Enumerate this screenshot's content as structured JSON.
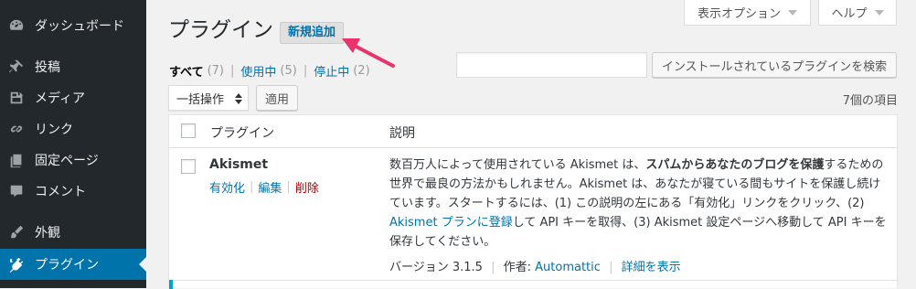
{
  "sidebar": {
    "items": [
      {
        "label": "ダッシュボード",
        "icon": "dashboard-icon"
      },
      {
        "label": "投稿",
        "icon": "pin-icon"
      },
      {
        "label": "メディア",
        "icon": "media-icon"
      },
      {
        "label": "リンク",
        "icon": "link-icon"
      },
      {
        "label": "固定ページ",
        "icon": "page-icon"
      },
      {
        "label": "コメント",
        "icon": "comment-icon"
      },
      {
        "label": "外観",
        "icon": "brush-icon"
      },
      {
        "label": "プラグイン",
        "icon": "plugin-icon"
      }
    ],
    "active_item": "プラグイン",
    "colors": {
      "background": "#23282d",
      "active": "#0073aa"
    }
  },
  "screen_meta": {
    "options_label": "表示オプション",
    "help_label": "ヘルプ"
  },
  "header": {
    "title": "プラグイン",
    "add_new_label": "新規追加"
  },
  "filters": {
    "all": {
      "label": "すべて",
      "count": "(7)"
    },
    "active": {
      "label": "使用中",
      "count": "(5)"
    },
    "inactive": {
      "label": "停止中",
      "count": "(2)"
    }
  },
  "search": {
    "value": "",
    "button_label": "インストールされているプラグインを検索"
  },
  "bulk_actions": {
    "selected": "一括操作",
    "apply_label": "適用"
  },
  "items_count": "7個の項目",
  "table": {
    "columns": {
      "plugin": "プラグイン",
      "description": "説明"
    },
    "rows": [
      {
        "name": "Akismet",
        "actions": {
          "activate": "有効化",
          "edit": "編集",
          "delete": "削除"
        },
        "description": {
          "part1": "数百万人によって使用されている Akismet は、",
          "bold": "スパムからあなたのブログを保護",
          "part2": "するための世界で最良の方法かもしれません。Akismet は、あなたが寝ている間もサイトを保護し続けています。スタートするには、(1) この説明の左にある「有効化」リンクをクリック、(2) ",
          "link": "Akismet プランに登録",
          "part3": "して API キーを取得、(3) Akismet 設定ページへ移動して API キーを保存してください。"
        },
        "meta": {
          "version": "バージョン 3.1.5",
          "author_prefix": "作者: ",
          "author": "Automattic",
          "details": "詳細を表示"
        }
      }
    ]
  },
  "accent_colors": {
    "link": "#0073aa",
    "delete": "#a00",
    "arrow": "#e8336c"
  }
}
